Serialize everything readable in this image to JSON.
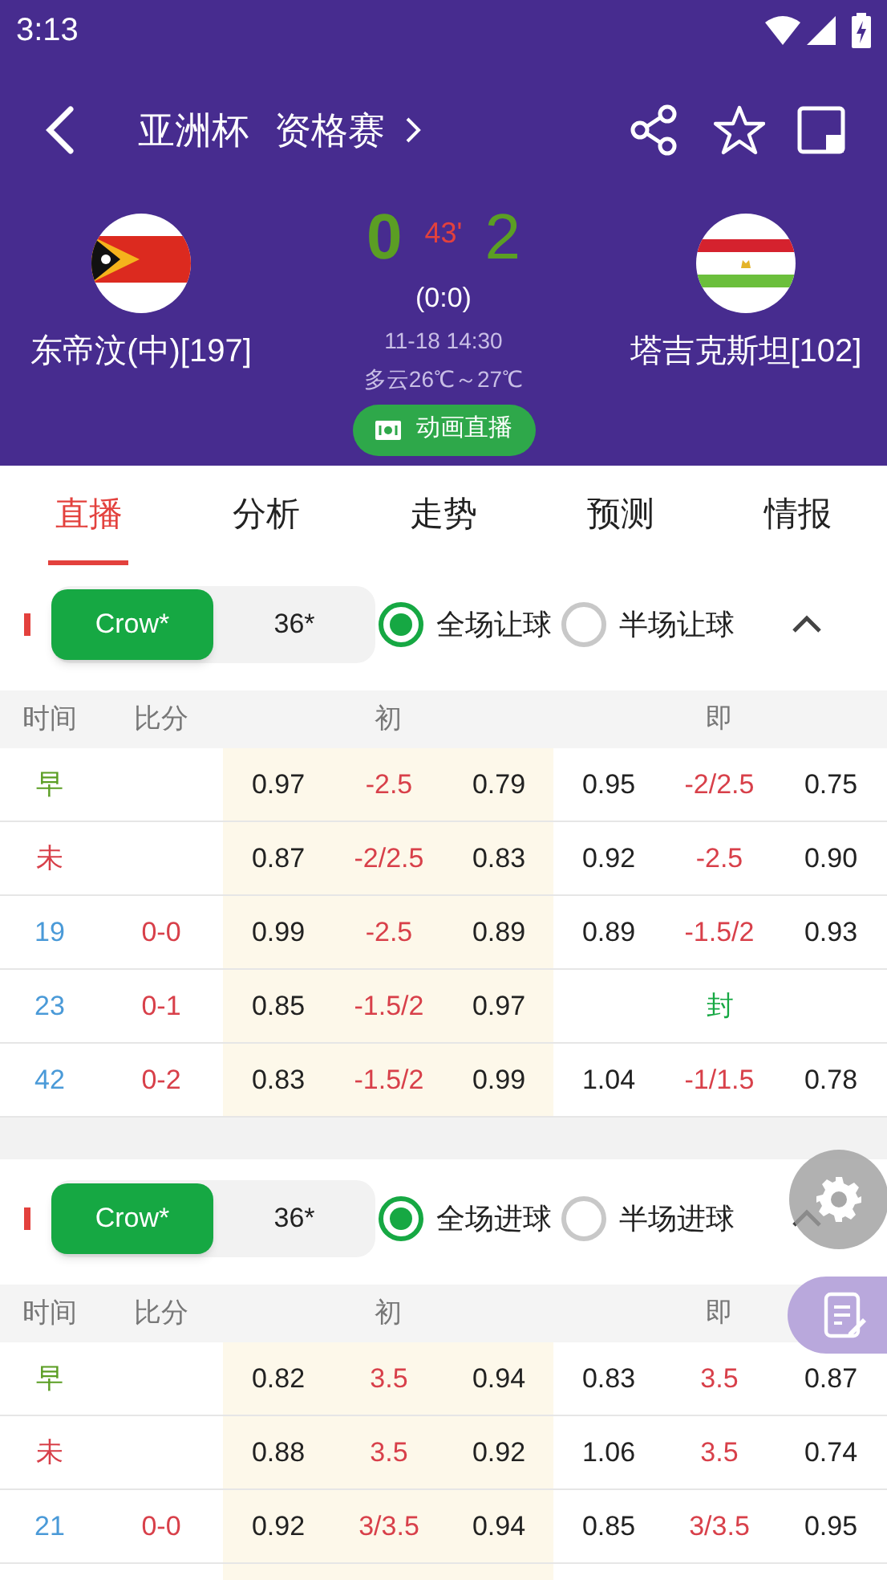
{
  "status_bar": {
    "time": "3:13"
  },
  "header": {
    "title": [
      "亚洲杯",
      "资格赛"
    ]
  },
  "match": {
    "home": {
      "name": "东帝汶(中)[197]"
    },
    "away": {
      "name": "塔吉克斯坦[102]"
    },
    "home_score": "0",
    "minute": "43'",
    "away_score": "2",
    "half_score": "(0:0)",
    "datetime": "11-18 14:30",
    "weather": "多云26℃～27℃",
    "live_button": "动画直播"
  },
  "tabs": [
    {
      "label": "直播",
      "selected": true
    },
    {
      "label": "分析",
      "selected": false
    },
    {
      "label": "走势",
      "selected": false
    },
    {
      "label": "预测",
      "selected": false
    },
    {
      "label": "情报",
      "selected": false
    }
  ],
  "sections": [
    {
      "bookmakers": [
        {
          "label": "Crow*",
          "selected": true
        },
        {
          "label": "36*",
          "selected": false
        }
      ],
      "options": [
        {
          "label": "全场让球",
          "selected": true
        },
        {
          "label": "半场让球",
          "selected": false
        }
      ],
      "expanded": true,
      "columns": [
        "时间",
        "比分",
        "初",
        "即"
      ],
      "rows": [
        {
          "kind": "early",
          "time": "早",
          "initial": [
            "0.97",
            "-2.5",
            "0.79"
          ],
          "live": [
            "0.95",
            "-2/2.5",
            "0.75"
          ]
        },
        {
          "kind": "closing",
          "time": "未",
          "initial": [
            "0.87",
            "-2/2.5",
            "0.83"
          ],
          "live": [
            "0.92",
            "-2.5",
            "0.90"
          ]
        },
        {
          "kind": "minute",
          "time": "19",
          "score": "0-0",
          "initial": [
            "0.99",
            "-2.5",
            "0.89"
          ],
          "live": [
            "0.89",
            "-1.5/2",
            "0.93"
          ]
        },
        {
          "kind": "minute",
          "time": "23",
          "score": "0-1",
          "initial": [
            "0.85",
            "-1.5/2",
            "0.97"
          ],
          "closed": "封"
        },
        {
          "kind": "minute",
          "time": "42",
          "score": "0-2",
          "initial": [
            "0.83",
            "-1.5/2",
            "0.99"
          ],
          "live": [
            "1.04",
            "-1/1.5",
            "0.78"
          ]
        }
      ]
    },
    {
      "bookmakers": [
        {
          "label": "Crow*",
          "selected": true
        },
        {
          "label": "36*",
          "selected": false
        }
      ],
      "options": [
        {
          "label": "全场进球",
          "selected": true
        },
        {
          "label": "半场进球",
          "selected": false
        }
      ],
      "expanded": true,
      "columns": [
        "时间",
        "比分",
        "初",
        "即"
      ],
      "rows": [
        {
          "kind": "early",
          "time": "早",
          "initial": [
            "0.82",
            "3.5",
            "0.94"
          ],
          "live": [
            "0.83",
            "3.5",
            "0.87"
          ]
        },
        {
          "kind": "closing",
          "time": "未",
          "initial": [
            "0.88",
            "3.5",
            "0.92"
          ],
          "live": [
            "1.06",
            "3.5",
            "0.74"
          ]
        },
        {
          "kind": "minute",
          "time": "21",
          "score": "0-0",
          "initial": [
            "0.92",
            "3/3.5",
            "0.94"
          ],
          "live": [
            "0.85",
            "3/3.5",
            "0.95"
          ]
        }
      ]
    }
  ]
}
